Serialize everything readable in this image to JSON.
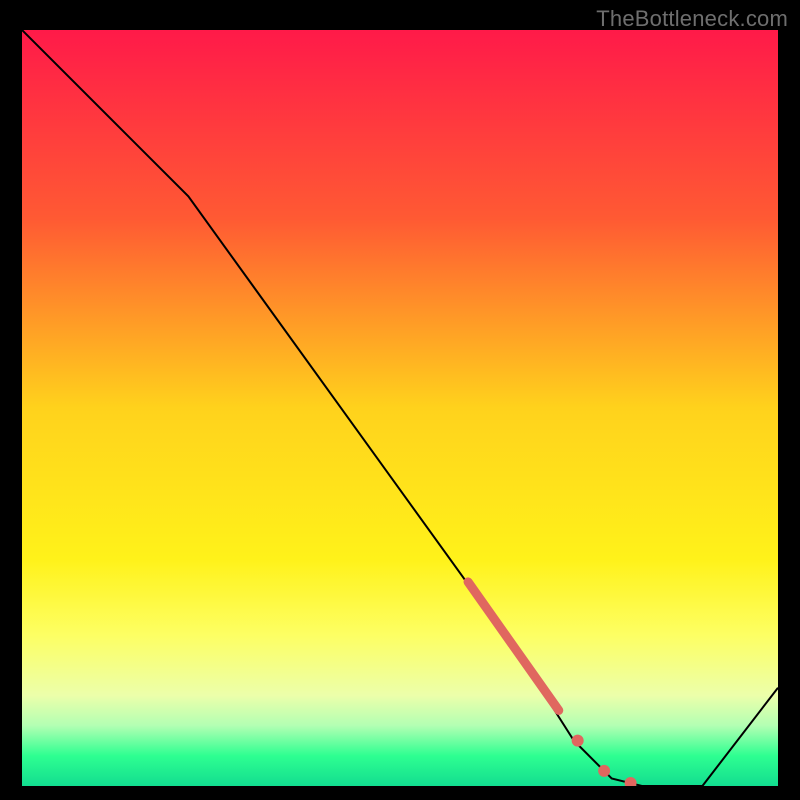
{
  "watermark": "TheBottleneck.com",
  "chart_data": {
    "type": "line",
    "title": "",
    "xlabel": "",
    "ylabel": "",
    "xlim": [
      0,
      100
    ],
    "ylim": [
      0,
      100
    ],
    "background_gradient": {
      "stops": [
        {
          "offset": 0.0,
          "color": "#ff1a49"
        },
        {
          "offset": 0.25,
          "color": "#ff5a33"
        },
        {
          "offset": 0.5,
          "color": "#ffd21c"
        },
        {
          "offset": 0.7,
          "color": "#fff21a"
        },
        {
          "offset": 0.8,
          "color": "#fdff63"
        },
        {
          "offset": 0.88,
          "color": "#ecffaa"
        },
        {
          "offset": 0.92,
          "color": "#b3ffb3"
        },
        {
          "offset": 0.96,
          "color": "#2eff91"
        },
        {
          "offset": 1.0,
          "color": "#12dd90"
        }
      ]
    },
    "series": [
      {
        "name": "bottleneck-curve",
        "stroke": "#000000",
        "stroke_width": 2,
        "points": [
          {
            "x": 0,
            "y": 100
          },
          {
            "x": 22,
            "y": 78
          },
          {
            "x": 66,
            "y": 17
          },
          {
            "x": 73,
            "y": 6
          },
          {
            "x": 78,
            "y": 1
          },
          {
            "x": 82,
            "y": 0
          },
          {
            "x": 90,
            "y": 0
          },
          {
            "x": 100,
            "y": 13
          }
        ]
      }
    ],
    "marker_band": {
      "name": "emphasis-segment",
      "color": "#e0675f",
      "stroke_width": 9,
      "points": [
        {
          "x": 59,
          "y": 27
        },
        {
          "x": 71,
          "y": 10
        }
      ]
    },
    "marker_dots": {
      "name": "emphasis-dots",
      "color": "#e0675f",
      "r": 6,
      "points": [
        {
          "x": 73.5,
          "y": 6
        },
        {
          "x": 77.0,
          "y": 2
        },
        {
          "x": 80.5,
          "y": 0.4
        }
      ]
    }
  }
}
